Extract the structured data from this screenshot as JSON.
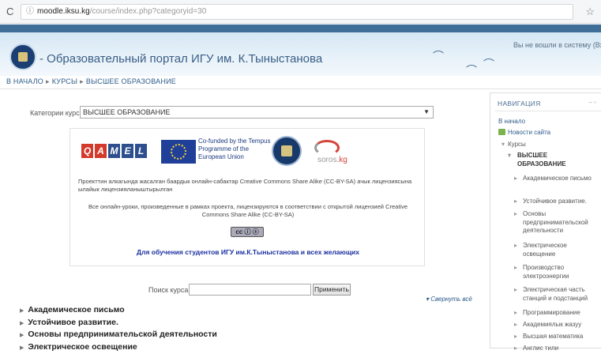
{
  "browser": {
    "reload_icon": "reload-icon",
    "info_icon": "info-icon",
    "url_host": "moodle.iksu.kg",
    "url_path": "/course/index.php?categoryid=30",
    "star_icon": "star-icon"
  },
  "header": {
    "site_title": "- Образовательный портал ИГУ им. К.Тыныстанова",
    "login_text": "Вы не вошли в систему (Вход"
  },
  "breadcrumb": {
    "home": "В НАЧАЛО",
    "courses": "КУРСЫ",
    "current": "ВЫСШЕЕ ОБРАЗОВАНИЕ",
    "sep": "▸"
  },
  "category": {
    "label": "Категории курсов:",
    "selected": "ВЫСШЕЕ ОБРАЗОВАНИЕ"
  },
  "promo": {
    "qamel_letters": [
      "Q",
      "A",
      "M",
      "E",
      "L"
    ],
    "qamel_colors": [
      "#d33a2c",
      "#d33a2c",
      "#2e4f8d",
      "#2e4f8d",
      "#2e4f8d"
    ],
    "eu_text": "Co-funded by the Tempus Programme of the European Union",
    "soros_prefix": "soros",
    "soros_suffix": ".kg",
    "ky_text": "Проекттин алкагында жасалган баардык онлайн-сабактар Creative Commons Share Alike (CC-BY-SA) ачык лицензиясына ылайык лицензияланыштырылган",
    "ru_text": "Все онлайн-уроки, произведенные в рамках проекта, лицензируются в соответствии с открытой лицензией Creative Commons Share Alike (CC-BY-SA)",
    "cc_badge": "cc ⓘ ⓢ",
    "students_text": "Для обучения студентов ИГУ им.К.Тыныстанова и всех желающих"
  },
  "search": {
    "label": "Поиск курса:",
    "value": "",
    "button": "Применить"
  },
  "collapse_label": "Свернуть всё",
  "courses": [
    "Академическое письмо",
    "Устойчивое развитие.",
    "Основы предпринимательской деятельности",
    "Электрическое освещение"
  ],
  "navigation": {
    "title": "НАВИГАЦИЯ",
    "home": "В начало",
    "site_news": "Новости сайта",
    "courses": "Курсы",
    "current_category": "ВЫСШЕЕ ОБРАЗОВАНИЕ",
    "items": [
      "Академическое письмо",
      "Устойчивое развитие.",
      "Основы предпринимательской деятельности",
      "Электрическое освещение",
      "Производство электроэнергии",
      "Электрическая часть станций и подстанций",
      "Программирование",
      "Академиялык жазуу",
      "Высшая математика",
      "Англис тили"
    ]
  }
}
